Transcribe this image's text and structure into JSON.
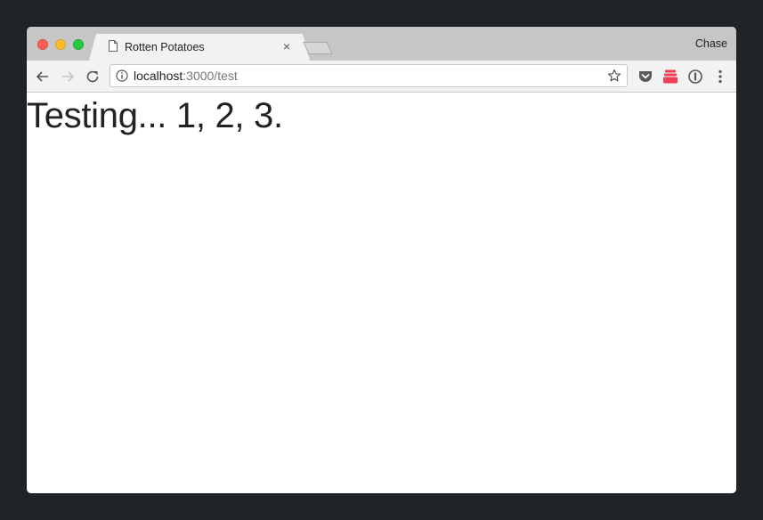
{
  "window": {
    "tab": {
      "title": "Rotten Potatoes",
      "close_glyph": "×"
    },
    "profile_name": "Chase"
  },
  "toolbar": {
    "url_host": "localhost",
    "url_path": ":3000/test",
    "icons": [
      "back-icon",
      "forward-icon",
      "reload-icon",
      "info-icon",
      "star-icon",
      "pocket-icon",
      "stack-extension-icon",
      "password-manager-icon",
      "menu-icon"
    ],
    "accent_colors": {
      "pocket": "#5b5b5b",
      "stack_extension": "#ee4056",
      "traffic_close": "#fc5f57",
      "traffic_min": "#fdbc2e",
      "traffic_max": "#28c840"
    }
  },
  "page": {
    "heading": "Testing... 1, 2, 3."
  }
}
